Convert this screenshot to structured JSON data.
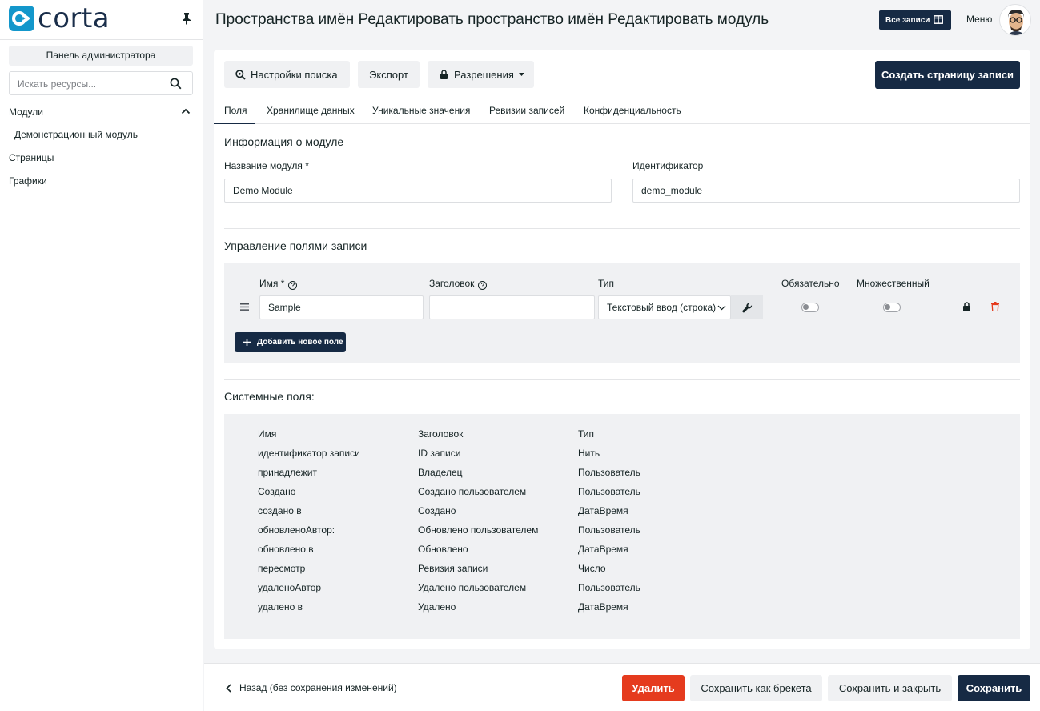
{
  "app": {
    "logo_text": "corta"
  },
  "sidebar": {
    "admin_panel": "Панель администратора",
    "search_placeholder": "Искать ресурсы...",
    "items": [
      {
        "label": "Модули"
      },
      {
        "label": "Демонстрационный модуль"
      },
      {
        "label": "Страницы"
      },
      {
        "label": "Графики"
      }
    ]
  },
  "header": {
    "title": "Пространства имён Редактировать пространство имён Редактировать модуль",
    "all_records": "Все записи",
    "menu": "Меню"
  },
  "toolbar": {
    "search_settings": "Настройки поиска",
    "export": "Экспорт",
    "permissions": "Разрешения",
    "create_record_page": "Создать страницу записи"
  },
  "tabs": [
    {
      "label": "Поля"
    },
    {
      "label": "Хранилище данных"
    },
    {
      "label": "Уникальные значения"
    },
    {
      "label": "Ревизии записей"
    },
    {
      "label": "Конфиденциальность"
    }
  ],
  "module_info": {
    "title": "Информация о модуле",
    "name_label": "Название модуля *",
    "name_value": "Demo Module",
    "handle_label": "Идентификатор",
    "handle_value": "demo_module"
  },
  "record_fields": {
    "title": "Управление полями записи",
    "col_name": "Имя *",
    "col_label": "Заголовок",
    "col_type": "Тип",
    "col_required": "Обязательно",
    "col_multiple": "Множественный",
    "row": {
      "name": "Sample",
      "label": "",
      "type": "Текстовый ввод (строка)"
    },
    "add_field": "Добавить новое поле"
  },
  "system_fields": {
    "title": "Системные поля:",
    "headers": [
      "Имя",
      "Заголовок",
      "Тип"
    ],
    "rows": [
      [
        "идентификатор записи",
        "ID записи",
        "Нить"
      ],
      [
        "принадлежит",
        "Владелец",
        "Пользователь"
      ],
      [
        "Создано",
        "Создано пользователем",
        "Пользователь"
      ],
      [
        "создано в",
        "Создано",
        "ДатаВремя"
      ],
      [
        "обновленоАвтор:",
        "Обновлено пользователем",
        "Пользователь"
      ],
      [
        "обновлено в",
        "Обновлено",
        "ДатаВремя"
      ],
      [
        "пересмотр",
        "Ревизия записи",
        "Число"
      ],
      [
        "удаленоАвтор",
        "Удалено пользователем",
        "Пользователь"
      ],
      [
        "удалено в",
        "Удалено",
        "ДатаВремя"
      ]
    ]
  },
  "footer": {
    "back": "Назад (без сохранения изменений)",
    "delete": "Удалить",
    "save_as_copy": "Сохранить как брекета",
    "save_and_close": "Сохранить и закрыть",
    "save": "Сохранить"
  },
  "colors": {
    "primary": "#162a44",
    "danger": "#e53b1e",
    "brand": "#1397cb"
  }
}
